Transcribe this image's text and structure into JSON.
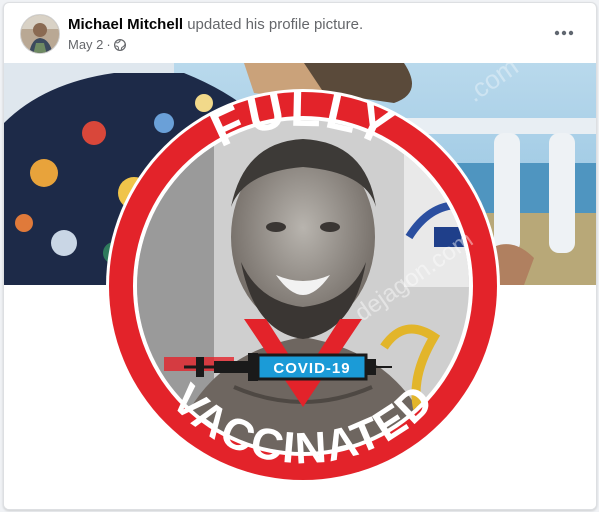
{
  "post": {
    "author": "Michael Mitchell",
    "action": "updated his profile picture.",
    "date": "May 2",
    "separator": "·",
    "privacy_icon": "globe-icon",
    "more_icon": "more-options-icon"
  },
  "profile_picture": {
    "top_text": "FULLY",
    "bottom_text": "VACCINATED",
    "syringe_label": "COVID-19",
    "watermark": "dejagon.com",
    "ring_color": "#e3232a",
    "label_color": "#1b9bd7"
  }
}
